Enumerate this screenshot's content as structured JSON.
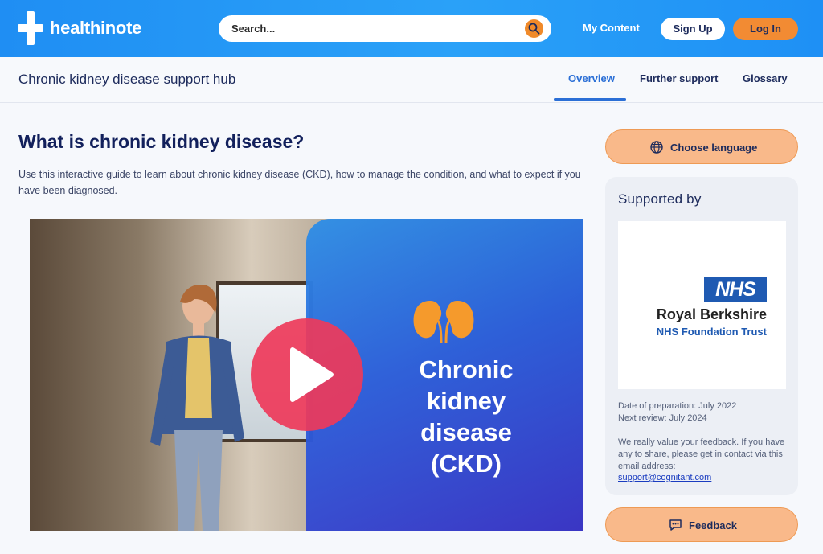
{
  "brand": {
    "name": "healthinote"
  },
  "header": {
    "search_placeholder": "Search...",
    "my_content": "My Content",
    "sign_up": "Sign Up",
    "log_in": "Log In"
  },
  "subheader": {
    "title": "Chronic kidney disease support hub",
    "tabs": [
      {
        "label": "Overview",
        "active": true
      },
      {
        "label": "Further support",
        "active": false
      },
      {
        "label": "Glossary",
        "active": false
      }
    ]
  },
  "main": {
    "title": "What is chronic kidney disease?",
    "intro": "Use this interactive guide to learn about chronic kidney disease (CKD), how to manage the condition, and what to expect if you have been diagnosed.",
    "video": {
      "title_lines": [
        "Chronic",
        "kidney",
        "disease",
        "(CKD)"
      ]
    }
  },
  "sidebar": {
    "choose_language": "Choose language",
    "supported_by": "Supported by",
    "logo": {
      "badge": "NHS",
      "org": "Royal Berkshire",
      "trust": "NHS Foundation Trust"
    },
    "date_of_preparation": "Date of preparation: July 2022",
    "next_review": "Next review: July 2024",
    "feedback_message": "We really value your feedback. If you have any to share, please get in contact via this email address:",
    "email": "support@cognitant.com",
    "feedback": "Feedback"
  },
  "colors": {
    "header_blue": "#1f8ef3",
    "accent_orange": "#f28b33",
    "button_peach": "#f9b98a",
    "active_tab": "#2b6fd6",
    "navy_text": "#1d2b5c",
    "play_red": "#ee3a5a"
  }
}
